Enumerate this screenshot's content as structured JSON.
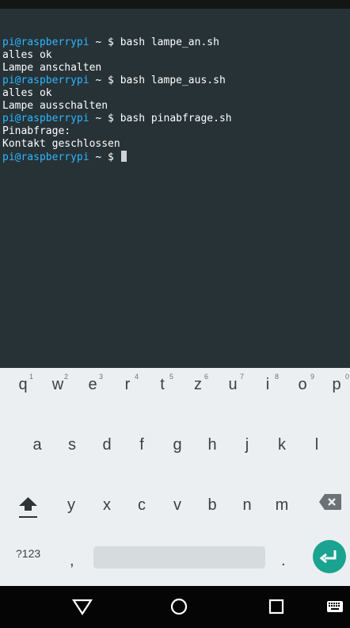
{
  "terminal": {
    "lines": [
      {
        "user": "pi@raspberrypi",
        "sep": " ~ $ ",
        "cmd": "bash lampe_an.sh"
      },
      {
        "text": "alles ok"
      },
      {
        "text": "Lampe anschalten"
      },
      {
        "user": "pi@raspberrypi",
        "sep": " ~ $ ",
        "cmd": "bash lampe_aus.sh"
      },
      {
        "text": "alles ok"
      },
      {
        "text": "Lampe ausschalten"
      },
      {
        "user": "pi@raspberrypi",
        "sep": " ~ $ ",
        "cmd": "bash pinabfrage.sh"
      },
      {
        "text": "Pinabfrage:"
      },
      {
        "text": "Kontakt geschlossen"
      },
      {
        "user": "pi@raspberrypi",
        "sep": " ~ $ ",
        "cmd": ""
      }
    ]
  },
  "keyboard": {
    "row1": [
      "q",
      "w",
      "e",
      "r",
      "t",
      "z",
      "u",
      "i",
      "o",
      "p"
    ],
    "row1_hints": [
      "1",
      "2",
      "3",
      "4",
      "5",
      "6",
      "7",
      "8",
      "9",
      "0"
    ],
    "row2": [
      "a",
      "s",
      "d",
      "f",
      "g",
      "h",
      "j",
      "k",
      "l"
    ],
    "row3": [
      "y",
      "x",
      "c",
      "v",
      "b",
      "n",
      "m"
    ],
    "symbols_label": "?123",
    "comma": ",",
    "period": ".",
    "shift_icon": "shift-icon",
    "backspace_icon": "backspace-icon",
    "enter_icon": "enter-icon",
    "enter_color": "#1aa390"
  },
  "navbar": {
    "back_icon": "back-triangle-icon",
    "home_icon": "home-circle-icon",
    "recents_icon": "recents-square-icon",
    "keyboard_icon": "keyboard-icon"
  }
}
